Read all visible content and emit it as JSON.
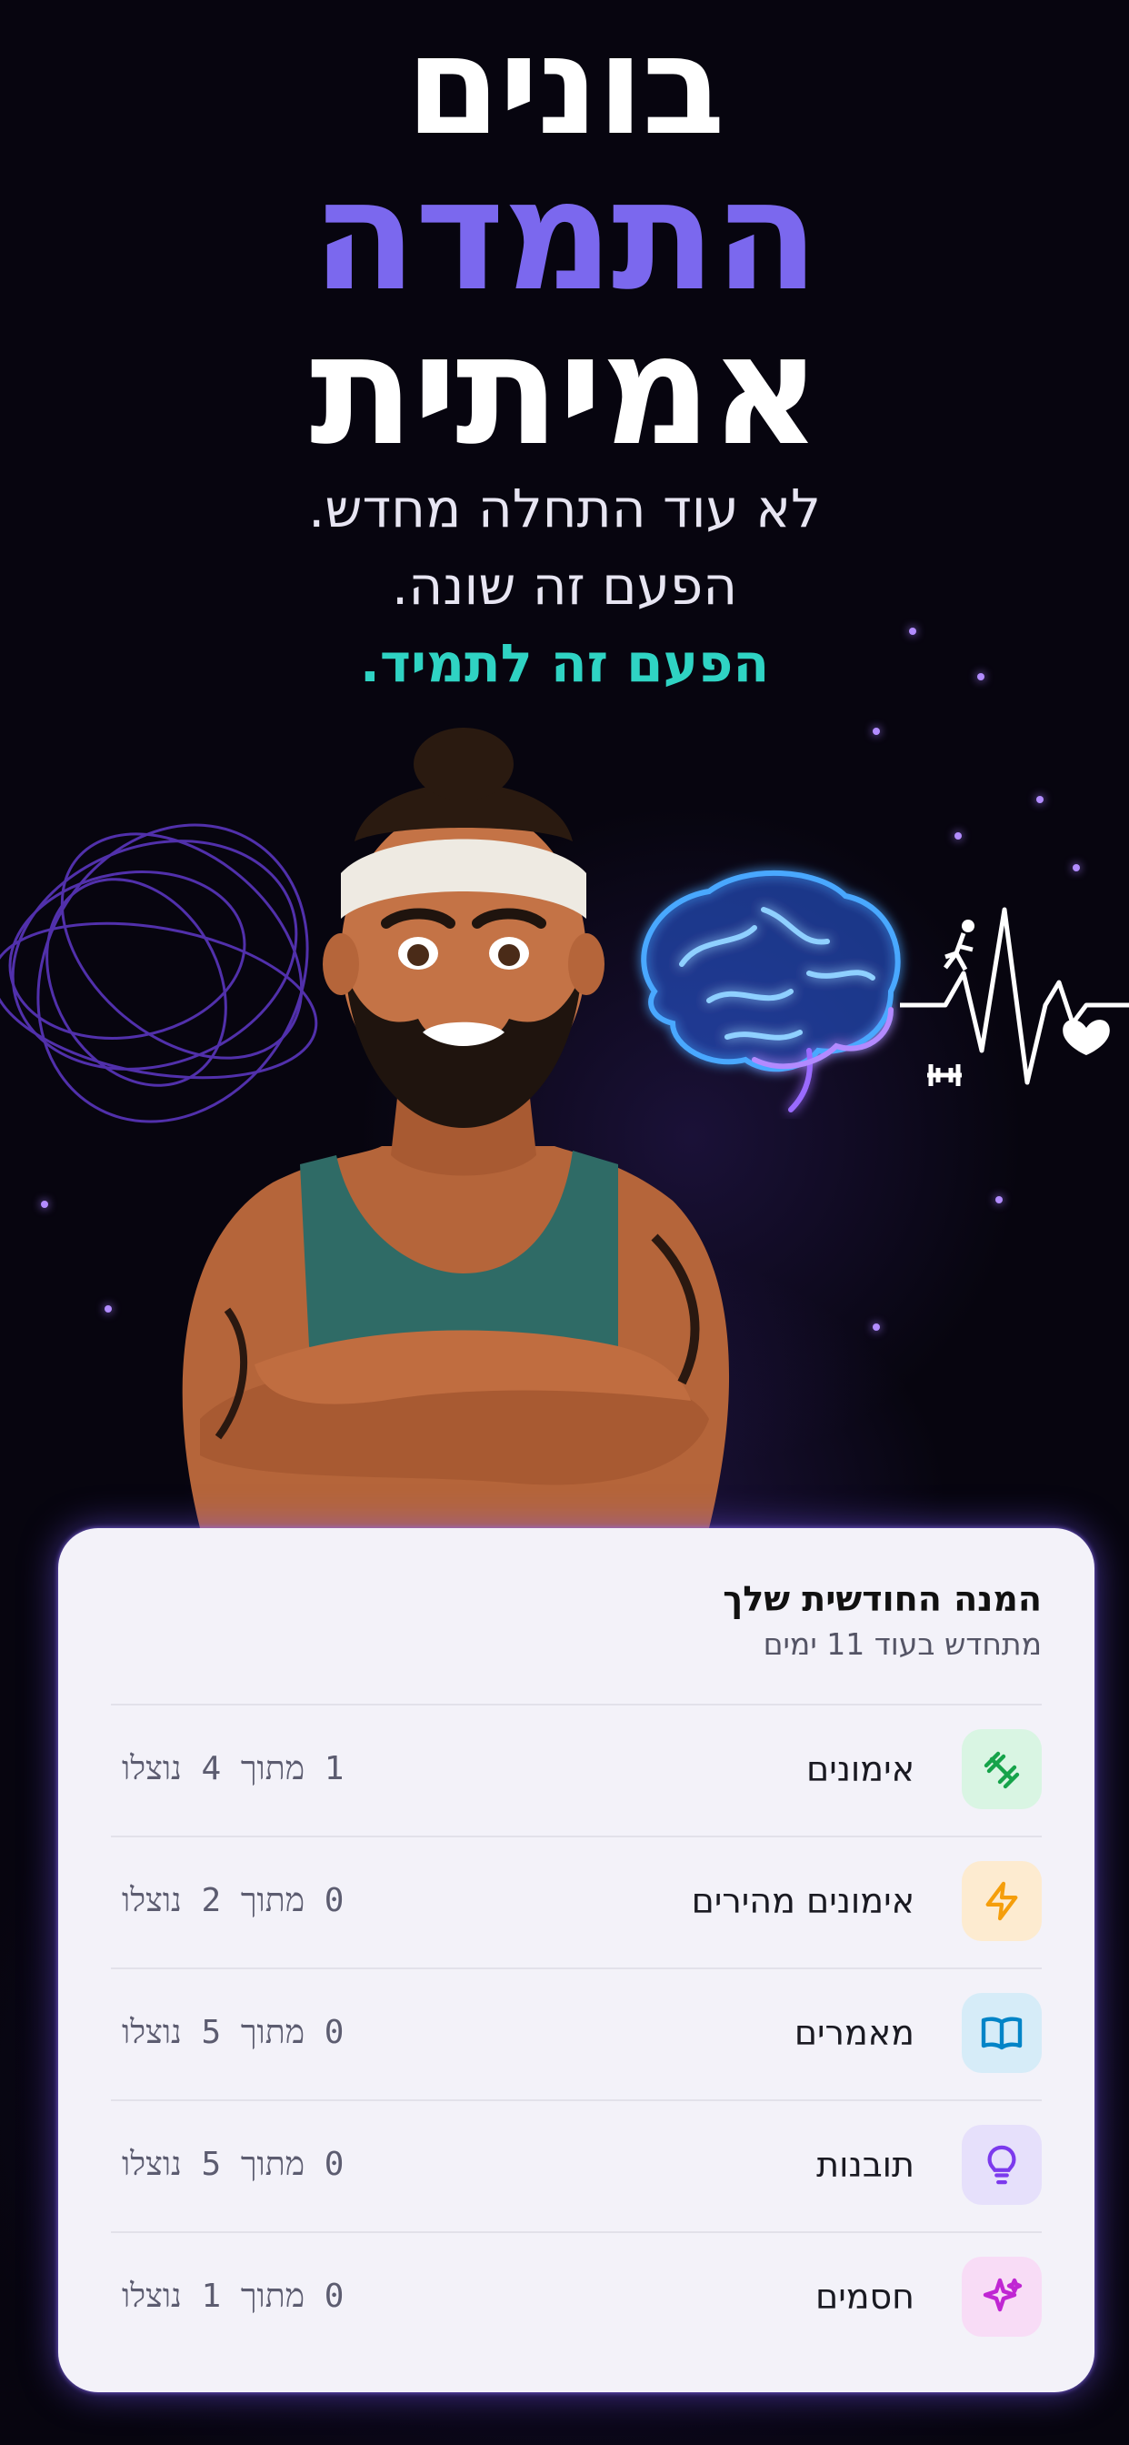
{
  "headline": {
    "line1": "בונים",
    "line2": "התמדה",
    "line3": "אמיתית"
  },
  "subtitle": {
    "line1": "לא עוד התחלה מחדש.",
    "line2": "הפעם זה שונה.",
    "line3": "הפעם זה לתמיד."
  },
  "colors": {
    "accent_purple": "#7b68ee",
    "accent_teal": "#2fd3c3",
    "background": "#07050f",
    "card": "#f3f2f9"
  },
  "card": {
    "title": "המנה החודשית שלך",
    "subtitle": "מתחדש בעוד 11 ימים",
    "items": [
      {
        "label": "אימונים",
        "count": "1 מתוך 4 נוצלו",
        "icon": "dumbbell-icon",
        "icon_color": "#16a34a",
        "icon_bg": "#d9f5e3"
      },
      {
        "label": "אימונים מהירים",
        "count": "0 מתוך 2 נוצלו",
        "icon": "lightning-icon",
        "icon_color": "#f59e0b",
        "icon_bg": "#fdebd0"
      },
      {
        "label": "מאמרים",
        "count": "0 מתוך 5 נוצלו",
        "icon": "book-icon",
        "icon_color": "#0284c7",
        "icon_bg": "#d6ecf8"
      },
      {
        "label": "תובנות",
        "count": "0 מתוך 5 נוצלו",
        "icon": "lightbulb-icon",
        "icon_color": "#7c3aed",
        "icon_bg": "#e6e0fb"
      },
      {
        "label": "חסמים",
        "count": "0 מתוך 1 נוצלו",
        "icon": "sparkle-icon",
        "icon_color": "#c026d3",
        "icon_bg": "#f8dcf6"
      }
    ]
  }
}
